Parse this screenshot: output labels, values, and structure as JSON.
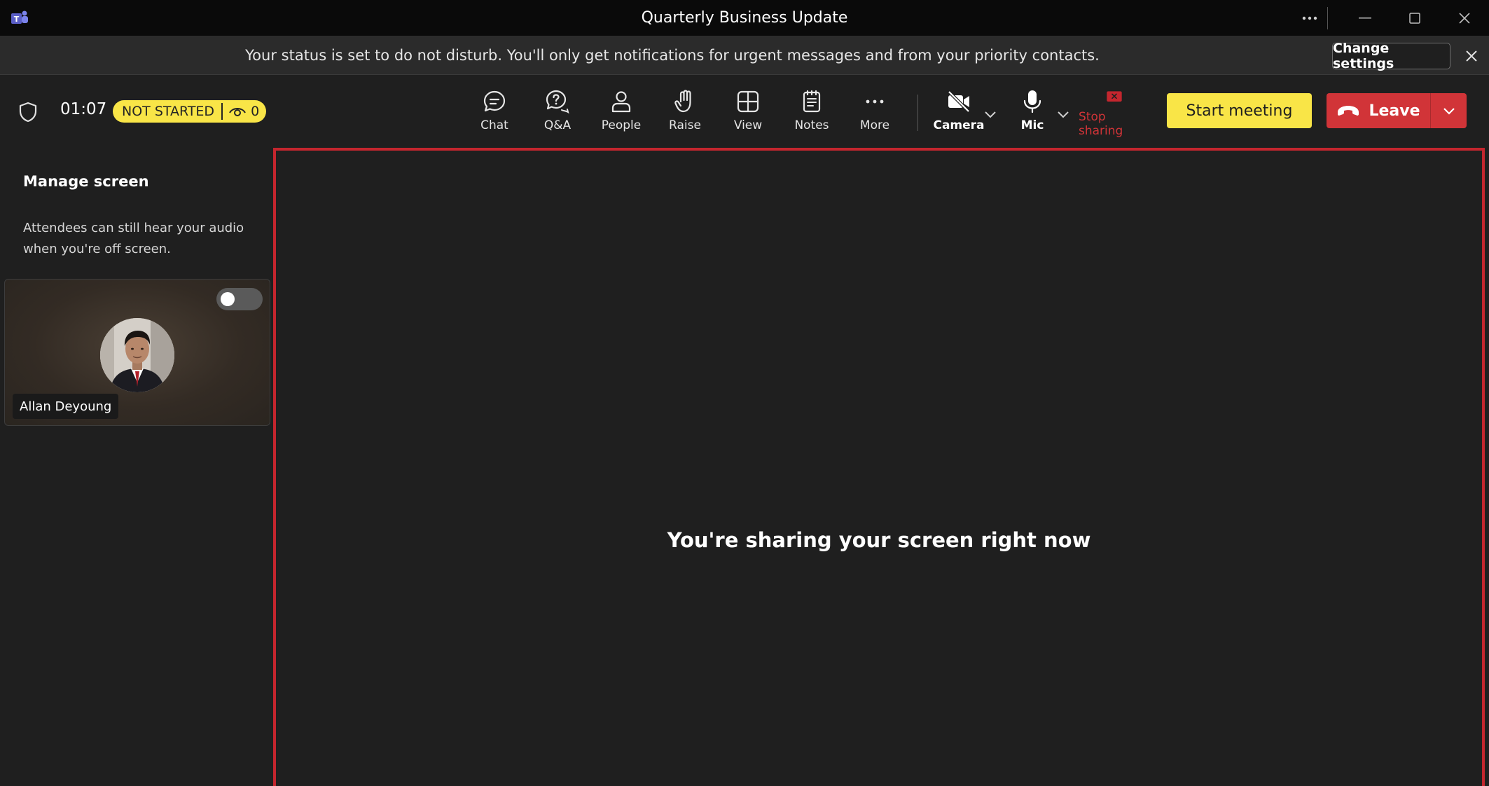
{
  "window": {
    "title": "Quarterly Business Update",
    "icons": {
      "app": "teams-logo-icon",
      "more": "more-horizontal-icon",
      "minimize": "minimize-icon",
      "maximize": "maximize-icon",
      "close": "close-icon"
    }
  },
  "banner": {
    "message": "Your status is set to do not disturb. You'll only get notifications for urgent messages and from your priority contacts.",
    "change_settings_label": "Change settings"
  },
  "toolbar": {
    "timer": "01:07",
    "status": "NOT STARTED",
    "viewer_count": "0",
    "items": [
      {
        "label": "Chat",
        "icon": "chat-icon"
      },
      {
        "label": "Q&A",
        "icon": "qa-icon"
      },
      {
        "label": "People",
        "icon": "people-icon"
      },
      {
        "label": "Raise",
        "icon": "hand-raise-icon"
      },
      {
        "label": "View",
        "icon": "view-grid-icon"
      },
      {
        "label": "Notes",
        "icon": "notes-icon"
      },
      {
        "label": "More",
        "icon": "more-icon"
      }
    ],
    "camera_label": "Camera",
    "mic_label": "Mic",
    "stop_sharing_label": "Stop sharing",
    "start_meeting_label": "Start meeting",
    "leave_label": "Leave"
  },
  "left_panel": {
    "title": "Manage screen",
    "description": "Attendees can still hear your audio when you're off screen.",
    "participant": {
      "name": "Allan Deyoung",
      "on_screen": false
    }
  },
  "stage": {
    "message": "You're sharing your screen right now"
  },
  "colors": {
    "accent_yellow": "#f9e547",
    "leave_red": "#d13438",
    "share_border": "#c4262e",
    "background": "#1f1f1f"
  }
}
